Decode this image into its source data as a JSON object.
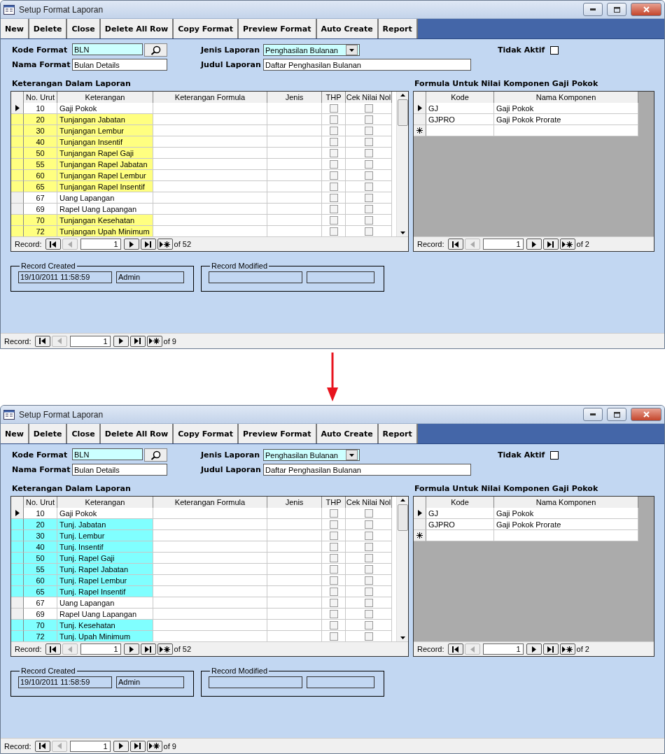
{
  "windows": [
    {
      "title": "Setup Format Laporan",
      "toolbar": [
        {
          "label": "New"
        },
        {
          "label": "Delete"
        },
        {
          "label": "Close"
        },
        {
          "label": "Delete All Row"
        },
        {
          "label": "Copy Format"
        },
        {
          "label": "Preview Format"
        },
        {
          "label": "Auto Create"
        },
        {
          "label": "Report"
        }
      ],
      "kode_format": {
        "label": "Kode Format",
        "value": "BLN"
      },
      "nama_format": {
        "label": "Nama Format",
        "value": "Bulan Details"
      },
      "jenis_laporan": {
        "label": "Jenis Laporan",
        "value": "Penghasilan Bulanan"
      },
      "judul_laporan": {
        "label": "Judul Laporan",
        "value": "Daftar Penghasilan Bulanan"
      },
      "tidak_aktif": {
        "label": "Tidak Aktif",
        "checked": false
      },
      "detail": {
        "title": "Keterangan Dalam Laporan",
        "columns": [
          "No. Urut",
          "Keterangan",
          "Keterangan Formula",
          "Jenis",
          "THP",
          "Cek Nilai Nol"
        ],
        "rows": [
          {
            "no": "10",
            "keterangan": "Gaji Pokok",
            "color": "#ffffff",
            "selected": true,
            "thp": false,
            "cek_nilai_nol": false
          },
          {
            "no": "20",
            "keterangan": "Tunjangan Jabatan",
            "color": "#ffff80",
            "selected": false,
            "thp": false,
            "cek_nilai_nol": false
          },
          {
            "no": "30",
            "keterangan": "Tunjangan Lembur",
            "color": "#ffff80",
            "selected": false,
            "thp": false,
            "cek_nilai_nol": false
          },
          {
            "no": "40",
            "keterangan": "Tunjangan Insentif",
            "color": "#ffff80",
            "selected": false,
            "thp": false,
            "cek_nilai_nol": false
          },
          {
            "no": "50",
            "keterangan": "Tunjangan Rapel Gaji",
            "color": "#ffff80",
            "selected": false,
            "thp": false,
            "cek_nilai_nol": false
          },
          {
            "no": "55",
            "keterangan": "Tunjangan Rapel Jabatan",
            "color": "#ffff80",
            "selected": false,
            "thp": false,
            "cek_nilai_nol": false
          },
          {
            "no": "60",
            "keterangan": "Tunjangan Rapel Lembur",
            "color": "#ffff80",
            "selected": false,
            "thp": false,
            "cek_nilai_nol": false
          },
          {
            "no": "65",
            "keterangan": "Tunjangan Rapel Insentif",
            "color": "#ffff80",
            "selected": false,
            "thp": false,
            "cek_nilai_nol": false
          },
          {
            "no": "67",
            "keterangan": "Uang Lapangan",
            "color": "#ffffff",
            "selected": false,
            "thp": false,
            "cek_nilai_nol": false
          },
          {
            "no": "69",
            "keterangan": "Rapel Uang Lapangan",
            "color": "#ffffff",
            "selected": false,
            "thp": false,
            "cek_nilai_nol": false
          },
          {
            "no": "70",
            "keterangan": "Tunjangan Kesehatan",
            "color": "#ffff80",
            "selected": false,
            "thp": false,
            "cek_nilai_nol": false
          },
          {
            "no": "72",
            "keterangan": "Tunjangan Upah Minimum",
            "color": "#ffff80",
            "selected": false,
            "thp": false,
            "cek_nilai_nol": false
          }
        ],
        "nav": {
          "label": "Record:",
          "current": "1",
          "total": "of  52"
        }
      },
      "formula": {
        "title": "Formula Untuk Nilai Komponen Gaji Pokok",
        "columns": [
          "Kode",
          "Nama Komponen"
        ],
        "rows": [
          {
            "kode": "GJ",
            "nama": "Gaji Pokok",
            "selected": true
          },
          {
            "kode": "GJPRO",
            "nama": "Gaji Pokok Prorate",
            "selected": false
          }
        ],
        "nav": {
          "label": "Record:",
          "current": "1",
          "total": "of  2"
        }
      },
      "record_created": {
        "title": "Record Created",
        "date": "19/10/2011 11:58:59",
        "user": "Admin"
      },
      "record_modified": {
        "title": "Record Modified"
      },
      "nav": {
        "label": "Record:",
        "current": "1",
        "total": "of  9"
      }
    },
    {
      "title": "Setup Format Laporan",
      "toolbar": [
        {
          "label": "New"
        },
        {
          "label": "Delete"
        },
        {
          "label": "Close"
        },
        {
          "label": "Delete All Row"
        },
        {
          "label": "Copy Format"
        },
        {
          "label": "Preview Format"
        },
        {
          "label": "Auto Create"
        },
        {
          "label": "Report"
        }
      ],
      "kode_format": {
        "label": "Kode Format",
        "value": "BLN"
      },
      "nama_format": {
        "label": "Nama Format",
        "value": "Bulan Details"
      },
      "jenis_laporan": {
        "label": "Jenis Laporan",
        "value": "Penghasilan Bulanan"
      },
      "judul_laporan": {
        "label": "Judul Laporan",
        "value": "Daftar Penghasilan Bulanan"
      },
      "tidak_aktif": {
        "label": "Tidak Aktif",
        "checked": false
      },
      "detail": {
        "title": "Keterangan Dalam Laporan",
        "columns": [
          "No. Urut",
          "Keterangan",
          "Keterangan Formula",
          "Jenis",
          "THP",
          "Cek Nilai Nol"
        ],
        "rows": [
          {
            "no": "10",
            "keterangan": "Gaji Pokok",
            "color": "#ffffff",
            "selected": true,
            "thp": false,
            "cek_nilai_nol": false
          },
          {
            "no": "20",
            "keterangan": "Tunj. Jabatan",
            "color": "#80ffff",
            "selected": false,
            "thp": false,
            "cek_nilai_nol": false
          },
          {
            "no": "30",
            "keterangan": "Tunj. Lembur",
            "color": "#80ffff",
            "selected": false,
            "thp": false,
            "cek_nilai_nol": false
          },
          {
            "no": "40",
            "keterangan": "Tunj. Insentif",
            "color": "#80ffff",
            "selected": false,
            "thp": false,
            "cek_nilai_nol": false
          },
          {
            "no": "50",
            "keterangan": "Tunj. Rapel Gaji",
            "color": "#80ffff",
            "selected": false,
            "thp": false,
            "cek_nilai_nol": false
          },
          {
            "no": "55",
            "keterangan": "Tunj. Rapel Jabatan",
            "color": "#80ffff",
            "selected": false,
            "thp": false,
            "cek_nilai_nol": false
          },
          {
            "no": "60",
            "keterangan": "Tunj. Rapel Lembur",
            "color": "#80ffff",
            "selected": false,
            "thp": false,
            "cek_nilai_nol": false
          },
          {
            "no": "65",
            "keterangan": "Tunj. Rapel Insentif",
            "color": "#80ffff",
            "selected": false,
            "thp": false,
            "cek_nilai_nol": false
          },
          {
            "no": "67",
            "keterangan": "Uang Lapangan",
            "color": "#ffffff",
            "selected": false,
            "thp": false,
            "cek_nilai_nol": false
          },
          {
            "no": "69",
            "keterangan": "Rapel Uang Lapangan",
            "color": "#ffffff",
            "selected": false,
            "thp": false,
            "cek_nilai_nol": false
          },
          {
            "no": "70",
            "keterangan": "Tunj. Kesehatan",
            "color": "#80ffff",
            "selected": false,
            "thp": false,
            "cek_nilai_nol": false
          },
          {
            "no": "72",
            "keterangan": "Tunj. Upah Minimum",
            "color": "#80ffff",
            "selected": false,
            "thp": false,
            "cek_nilai_nol": false
          }
        ],
        "nav": {
          "label": "Record:",
          "current": "1",
          "total": "of  52"
        }
      },
      "formula": {
        "title": "Formula Untuk Nilai Komponen Gaji Pokok",
        "columns": [
          "Kode",
          "Nama Komponen"
        ],
        "rows": [
          {
            "kode": "GJ",
            "nama": "Gaji Pokok",
            "selected": true
          },
          {
            "kode": "GJPRO",
            "nama": "Gaji Pokok Prorate",
            "selected": false
          }
        ],
        "nav": {
          "label": "Record:",
          "current": "1",
          "total": "of  2"
        }
      },
      "record_created": {
        "title": "Record Created",
        "date": "19/10/2011 11:58:59",
        "user": "Admin"
      },
      "record_modified": {
        "title": "Record Modified"
      },
      "nav": {
        "label": "Record:",
        "current": "1",
        "total": "of  9"
      }
    }
  ]
}
